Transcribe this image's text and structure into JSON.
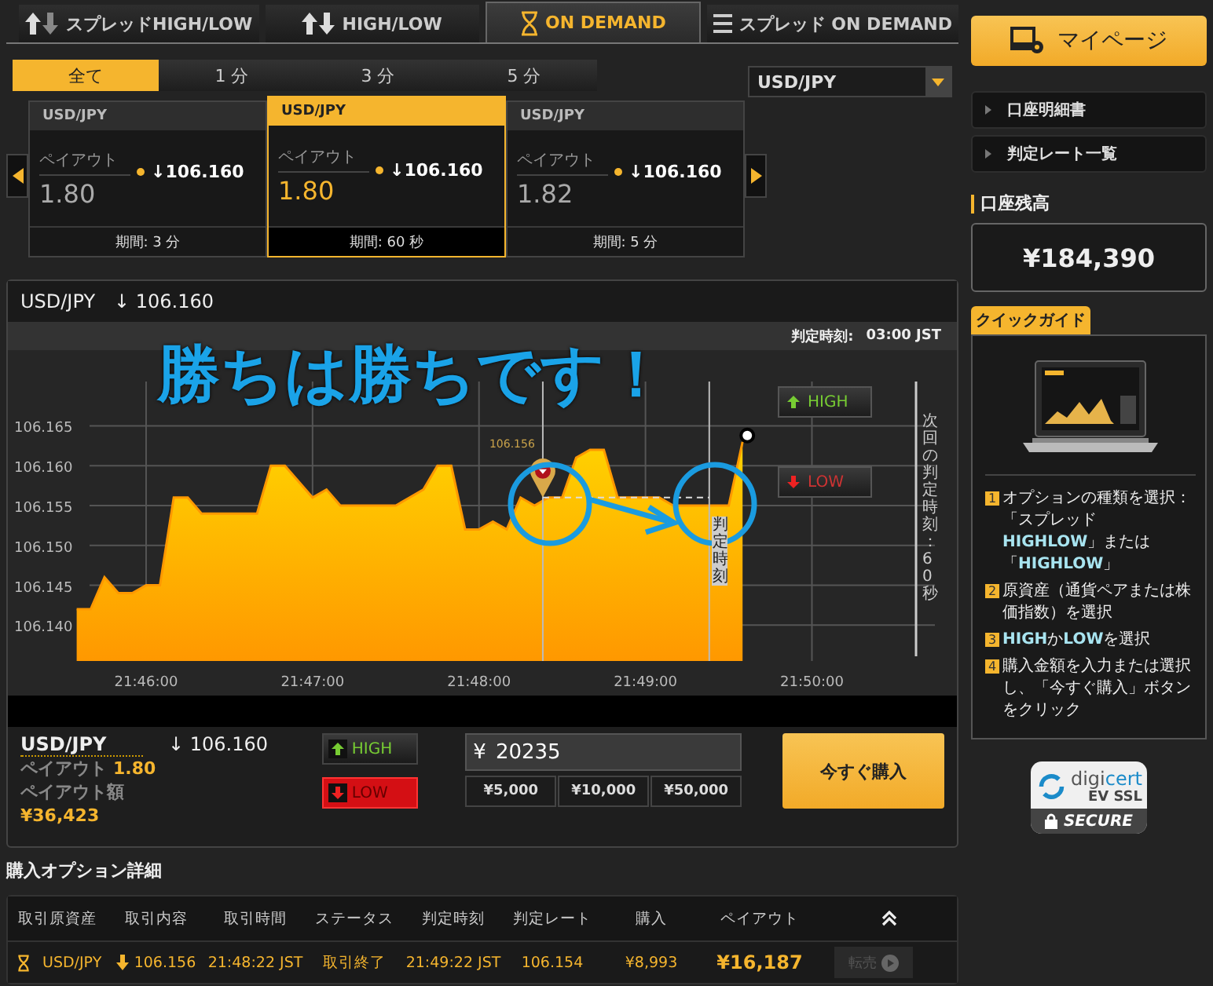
{
  "tabs": [
    {
      "label": "スプレッドHIGH/LOW",
      "kind": "spread-updown",
      "selected": false
    },
    {
      "label": "HIGH/LOW",
      "kind": "updown",
      "selected": false
    },
    {
      "label": "ON DEMAND",
      "kind": "hourglass",
      "selected": true
    },
    {
      "label": "スプレッド ON DEMAND",
      "kind": "spread-list",
      "selected": false
    }
  ],
  "duration_filters": [
    {
      "label": "全て",
      "selected": true
    },
    {
      "label": "1 分",
      "selected": false
    },
    {
      "label": "3 分",
      "selected": false
    },
    {
      "label": "5 分",
      "selected": false
    }
  ],
  "asset_select": {
    "value": "USD/JPY"
  },
  "cards": [
    {
      "pair": "USD/JPY",
      "payout_label": "ペイアウト",
      "payout": "1.80",
      "rate": "↓106.160",
      "period": "期間: 3 分",
      "selected": false
    },
    {
      "pair": "USD/JPY",
      "payout_label": "ペイアウト",
      "payout": "1.80",
      "rate": "↓106.160",
      "period": "期間: 60 秒",
      "selected": true
    },
    {
      "pair": "USD/JPY",
      "payout_label": "ペイアウト",
      "payout": "1.82",
      "rate": "↓106.160",
      "period": "期間: 5 分",
      "selected": false
    }
  ],
  "chart_panel": {
    "pair": "USD/JPY",
    "rate": "↓ 106.160",
    "expiry_label": "判定時刻:",
    "expiry_time": "03:00 JST",
    "caption": "勝ちは勝ちです！",
    "high_button": "HIGH",
    "low_button": "LOW",
    "entry_label": "106.156",
    "expiry_marker": "判定時刻",
    "next_expiry": "次回の判定時刻：60秒",
    "chart_data": {
      "type": "area",
      "categories": [
        null,
        null,
        null,
        null,
        null,
        "21:46:00",
        null,
        null,
        null,
        null,
        null,
        null,
        null,
        null,
        null,
        null,
        null,
        "21:47:00",
        null,
        null,
        null,
        null,
        null,
        null,
        null,
        null,
        null,
        null,
        null,
        "21:48:00",
        null,
        null,
        null,
        null,
        null,
        null,
        null,
        null,
        null,
        null,
        null,
        "21:49:00",
        null,
        null,
        null,
        null,
        null,
        null,
        null,
        null,
        null,
        null,
        null,
        "21:50:00"
      ],
      "series": [
        {
          "color": "#ff9800",
          "values": [
            106.142,
            106.142,
            106.146,
            106.144,
            106.144,
            106.145,
            106.145,
            106.156,
            106.156,
            106.154,
            106.154,
            106.154,
            106.154,
            106.154,
            106.16,
            106.16,
            106.158,
            106.156,
            106.157,
            106.155,
            106.155,
            106.155,
            106.155,
            106.155,
            106.156,
            106.157,
            106.16,
            106.16,
            106.152,
            106.152,
            106.153,
            106.152,
            106.156,
            106.155,
            106.156,
            106.156,
            106.161,
            106.162,
            106.162,
            106.156,
            106.156,
            106.156,
            106.156,
            106.155,
            106.155,
            106.155,
            106.155,
            106.155,
            106.163,
            null,
            null,
            null,
            null,
            null
          ]
        }
      ],
      "yticks": [
        {
          "value": 106.14,
          "label": "106.140"
        },
        {
          "value": 106.145,
          "label": "106.145"
        },
        {
          "value": 106.15,
          "label": "106.150"
        },
        {
          "value": 106.155,
          "label": "106.155"
        },
        {
          "value": 106.16,
          "label": "106.160"
        },
        {
          "value": 106.165,
          "label": "106.165"
        }
      ],
      "grid": true,
      "ylim": [
        106.1355,
        106.1745
      ]
    }
  },
  "trade": {
    "pair": "USD/JPY",
    "rate": "↓ 106.160",
    "payout_label": "ペイアウト",
    "payout": "1.80",
    "amount_label": "ペイアウト額",
    "amount": "¥36,423",
    "directions": [
      {
        "label": "HIGH",
        "kind": "high",
        "selected": false
      },
      {
        "label": "LOW",
        "kind": "low",
        "selected": true
      }
    ],
    "currency": "¥",
    "investment": "20235",
    "quick_amounts": [
      "¥5,000",
      "¥10,000",
      "¥50,000"
    ],
    "buy_button": "今すぐ購入"
  },
  "history": {
    "title": "購入オプション詳細",
    "columns": [
      "取引原資産",
      "取引内容",
      "取引時間",
      "ステータス",
      "判定時刻",
      "判定レート",
      "購入",
      "ペイアウト"
    ],
    "rows": [
      {
        "asset": "USD/JPY",
        "kind": "low",
        "rate": "106.156",
        "time": "21:48:22 JST",
        "status": "取引終了",
        "expiry": "21:49:22 JST",
        "expiry_rate": "106.154",
        "purchase": "¥8,993",
        "payout": "¥16,187",
        "resell": "転売",
        "resell_disabled": true
      }
    ]
  },
  "sidebar": {
    "mypage_button": "マイページ",
    "menu": [
      "口座明細書",
      "判定レート一覧"
    ],
    "balance_label": "口座残高",
    "balance": "¥184,390",
    "guide_tab": "クイックガイド",
    "steps": [
      {
        "number": "1",
        "text": "オプションの種類を選択：「スプレッド**HIGHLOW**」または「**HIGHLOW**」"
      },
      {
        "number": "2",
        "text": "原資産（通貨ペアまたは株価指数）を選択"
      },
      {
        "number": "3",
        "text": "**HIGH**か**LOW**を選択"
      },
      {
        "number": "4",
        "text": "購入金額を入力または選択し、「今すぐ購入」ボタンをクリック"
      }
    ],
    "ssl_badge": {
      "brand": "digi**cert**",
      "line": "EV SSL",
      "status": "SECURE"
    }
  }
}
